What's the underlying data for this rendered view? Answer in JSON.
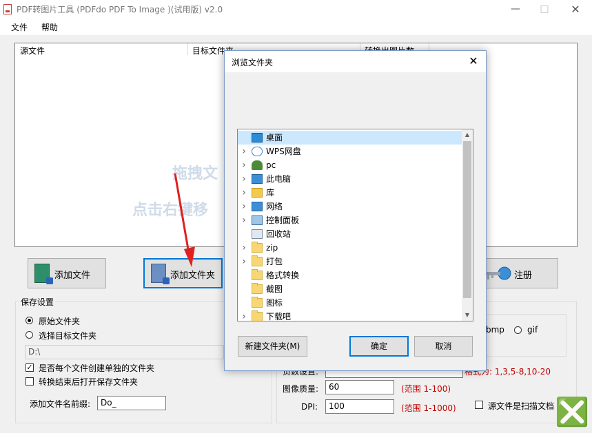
{
  "window": {
    "title": "PDF转图片工具 (PDFdo PDF To Image )(试用版) v2.0",
    "minimize_icon": "minimize-icon",
    "maximize_icon": "maximize-icon",
    "close_icon": "close-icon"
  },
  "menu": {
    "file": "文件",
    "help": "帮助"
  },
  "file_list": {
    "columns": [
      "源文件",
      "目标文件夹",
      "转换出图片数"
    ],
    "hint_line1": "拖拽文",
    "hint_line2": "点击右键移"
  },
  "buttons": {
    "add_file": "添加文件",
    "add_folder": "添加文件夹",
    "register": "注册"
  },
  "save_settings": {
    "title": "保存设置",
    "opt_original": "原始文件夹",
    "opt_choose": "选择目标文件夹",
    "path_value": "D:\\",
    "create_folder": "是否每个文件创建单独的文件夹",
    "open_after": "转换结束后打开保存文件夹",
    "prefix_label": "添加文件名前缀:",
    "prefix_value": "Do_"
  },
  "output_settings": {
    "format_bmp": "bmp",
    "format_gif": "gif",
    "page_label": "页数设置:",
    "page_hint": "格式为: 1,3,5-8,10-20",
    "quality_label": "图像质量:",
    "quality_value": "60",
    "quality_hint": "(范围 1-100)",
    "dpi_label": "DPI:",
    "dpi_value": "100",
    "dpi_hint": "(范围 1-1000)",
    "scan_doc": "源文件是扫描文档"
  },
  "dialog": {
    "title": "浏览文件夹",
    "tree": [
      {
        "label": "桌面",
        "icon": "desktop-icon",
        "expandable": false,
        "selected": true
      },
      {
        "label": "WPS网盘",
        "icon": "cloud-icon",
        "expandable": true
      },
      {
        "label": "pc",
        "icon": "user-icon",
        "expandable": true
      },
      {
        "label": "此电脑",
        "icon": "computer-icon",
        "expandable": true
      },
      {
        "label": "库",
        "icon": "library-icon",
        "expandable": true
      },
      {
        "label": "网络",
        "icon": "network-icon",
        "expandable": true
      },
      {
        "label": "控制面板",
        "icon": "control-panel-icon",
        "expandable": true
      },
      {
        "label": "回收站",
        "icon": "recycle-bin-icon",
        "expandable": false
      },
      {
        "label": "zip",
        "icon": "folder-icon",
        "expandable": true
      },
      {
        "label": "打包",
        "icon": "folder-icon",
        "expandable": true
      },
      {
        "label": "格式转换",
        "icon": "folder-icon",
        "expandable": false
      },
      {
        "label": "截图",
        "icon": "folder-icon",
        "expandable": false
      },
      {
        "label": "图标",
        "icon": "folder-icon",
        "expandable": false
      },
      {
        "label": "下载吧",
        "icon": "folder-icon",
        "expandable": true
      }
    ],
    "new_folder": "新建文件夹(M)",
    "ok": "确定",
    "cancel": "取消"
  },
  "colors": {
    "accent": "#0078d7",
    "selection": "#cce8ff",
    "annotation_arrow": "#e02020",
    "hint_text": "#c00000"
  }
}
